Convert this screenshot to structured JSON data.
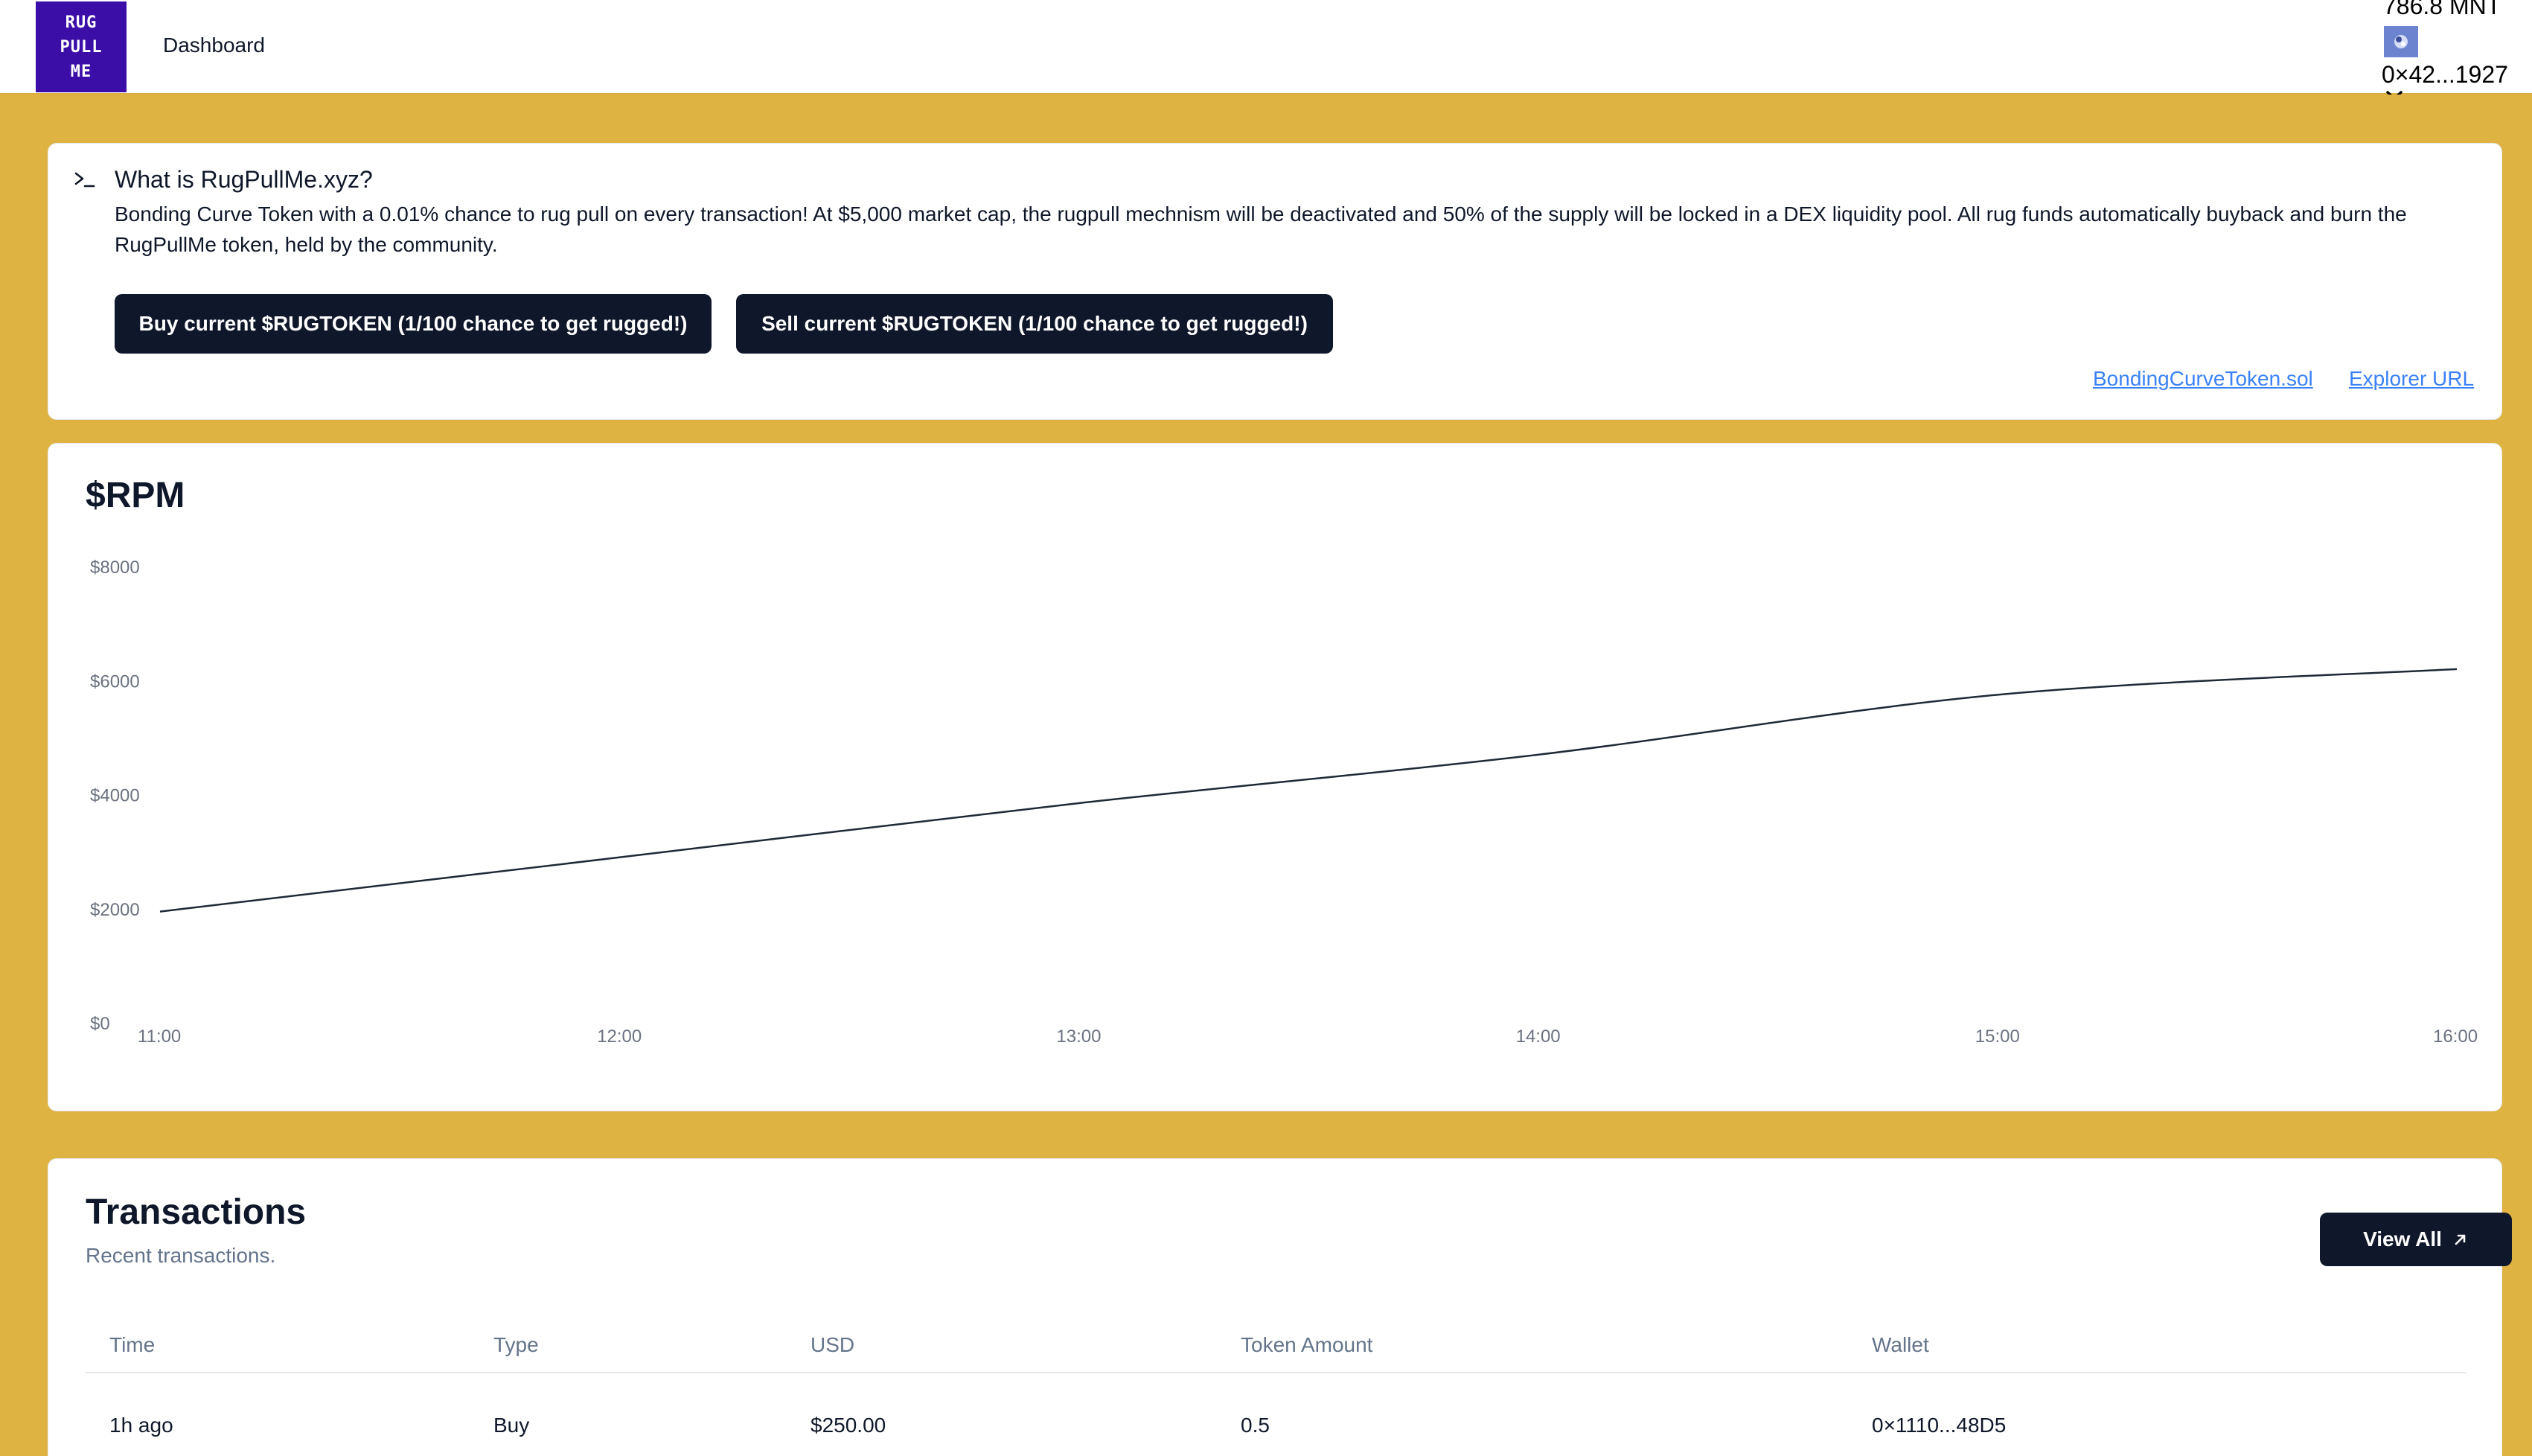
{
  "header": {
    "logo_lines": [
      "RUG",
      "PULL",
      "ME"
    ],
    "nav_label": "Dashboard",
    "balance": "786.8 MNT",
    "wallet_address": "0×42...1927",
    "avatar_icon": "wallet-avatar-icon",
    "chevron_icon": "chevron-down-icon"
  },
  "info": {
    "icon": "terminal-icon",
    "title": "What is RugPullMe.xyz?",
    "description": "Bonding Curve Token with a 0.01% chance to rug pull on every transaction! At $5,000 market cap, the rugpull mechnism will be deactivated and 50% of the supply will be locked in a DEX liquidity pool. All rug funds automatically buyback and burn the RugPullMe token, held by the community.",
    "buy_label": "Buy current $RUGTOKEN (1/100 chance to get rugged!)",
    "sell_label": "Sell current $RUGTOKEN (1/100 chance to get rugged!)",
    "contract_link": "BondingCurveToken.sol",
    "explorer_link": "Explorer URL"
  },
  "chart": {
    "title": "$RPM"
  },
  "chart_data": {
    "type": "line",
    "x": [
      "11:00",
      "12:00",
      "13:00",
      "14:00",
      "15:00",
      "16:00"
    ],
    "series": [
      {
        "values": [
          1950,
          2900,
          3850,
          4700,
          5750,
          6200
        ]
      }
    ],
    "y_ticks": [
      "$0",
      "$2000",
      "$4000",
      "$6000",
      "$8000"
    ],
    "ylim": [
      0,
      8000
    ],
    "grid": false,
    "line_color": "#1f2937"
  },
  "transactions": {
    "title": "Transactions",
    "subtitle": "Recent transactions.",
    "view_all_label": "View All",
    "view_all_icon": "arrow-up-right-icon",
    "columns": [
      "Time",
      "Type",
      "USD",
      "Token Amount",
      "Wallet"
    ],
    "rows": [
      {
        "time": "1h ago",
        "type": "Buy",
        "usd": "$250.00",
        "token_amount": "0.5",
        "wallet": "0×1110...48D5"
      }
    ]
  }
}
